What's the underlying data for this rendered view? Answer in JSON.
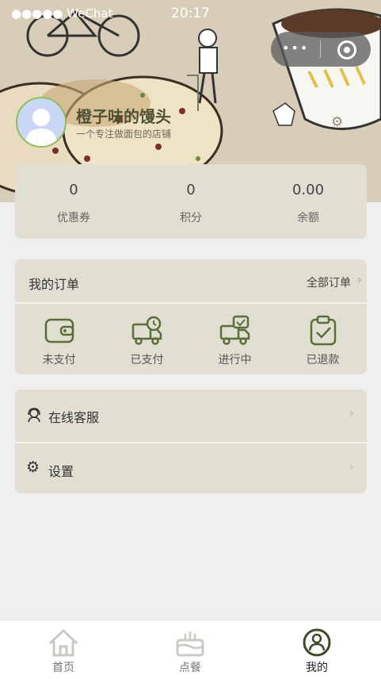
{
  "status_bar": {
    "carrier": "●●●●● WeChat",
    "time": "20:17"
  },
  "profile": {
    "name": "橙子味的馒头",
    "description": "一个专注做面包的店铺"
  },
  "stats": [
    {
      "value": "0",
      "label": "优惠券"
    },
    {
      "value": "0",
      "label": "积分"
    },
    {
      "value": "0.00",
      "label": "余额"
    }
  ],
  "orders": {
    "title": "我的订单",
    "all_label": "全部订单",
    "items": [
      {
        "label": "未支付",
        "icon": "wallet-icon"
      },
      {
        "label": "已支付",
        "icon": "delivery-truck-clock-icon"
      },
      {
        "label": "进行中",
        "icon": "delivery-truck-check-icon"
      },
      {
        "label": "已退款",
        "icon": "clipboard-check-icon"
      }
    ]
  },
  "menu": {
    "service_label": "在线客服",
    "settings_label": "设置"
  },
  "tabbar": {
    "items": [
      {
        "label": "首页",
        "icon": "home-icon"
      },
      {
        "label": "点餐",
        "icon": "cake-icon"
      },
      {
        "label": "我的",
        "icon": "user-profile-icon"
      }
    ],
    "active_index": 2
  },
  "colors": {
    "card_bg": "#e1dfd2",
    "accent_olive": "#5b6e3a",
    "page_bg": "#efefef"
  }
}
